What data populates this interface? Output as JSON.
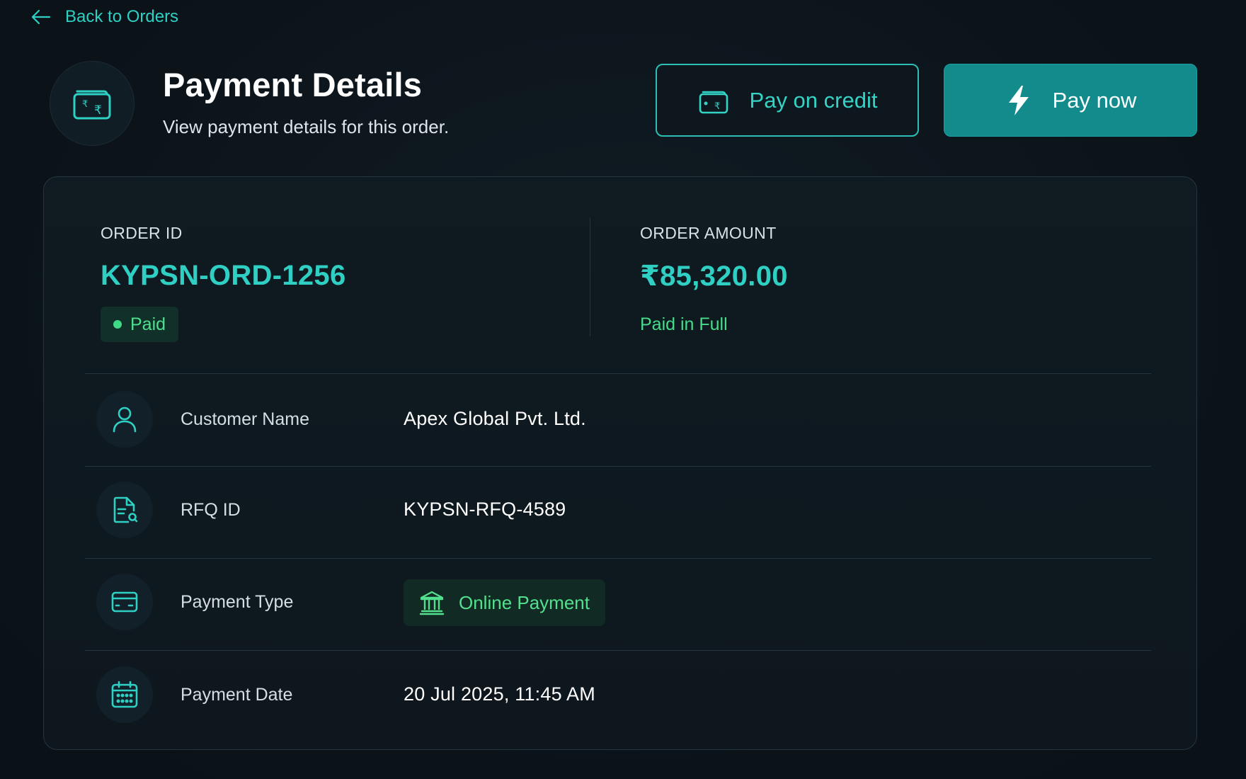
{
  "nav": {
    "back_label": "Back to Orders"
  },
  "header": {
    "title": "Payment Details",
    "subtitle": "View payment details for this order."
  },
  "actions": {
    "pay_on_credit": "Pay on credit",
    "pay_now": "Pay now"
  },
  "order": {
    "id_label": "ORDER ID",
    "id_value": "KYPSN-ORD-1256",
    "status": "Paid",
    "amount_label": "ORDER AMOUNT",
    "amount_value": "₹85,320.00",
    "amount_note": "Paid in Full"
  },
  "details": [
    {
      "icon": "user-icon",
      "label": "Customer Name",
      "value": "Apex Global Pvt. Ltd."
    },
    {
      "icon": "document-search-icon",
      "label": "RFQ ID",
      "value": "KYPSN-RFQ-4589"
    },
    {
      "icon": "credit-card-icon",
      "label": "Payment Type",
      "value": "Online Payment",
      "badge_icon": "bank-icon"
    },
    {
      "icon": "calendar-icon",
      "label": "Payment Date",
      "value": "20 Jul 2025, 11:45 AM"
    }
  ],
  "colors": {
    "accent": "#2fd0c4",
    "primary_button": "#138b8d",
    "success": "#45dc8a",
    "background": "#0c141b"
  }
}
